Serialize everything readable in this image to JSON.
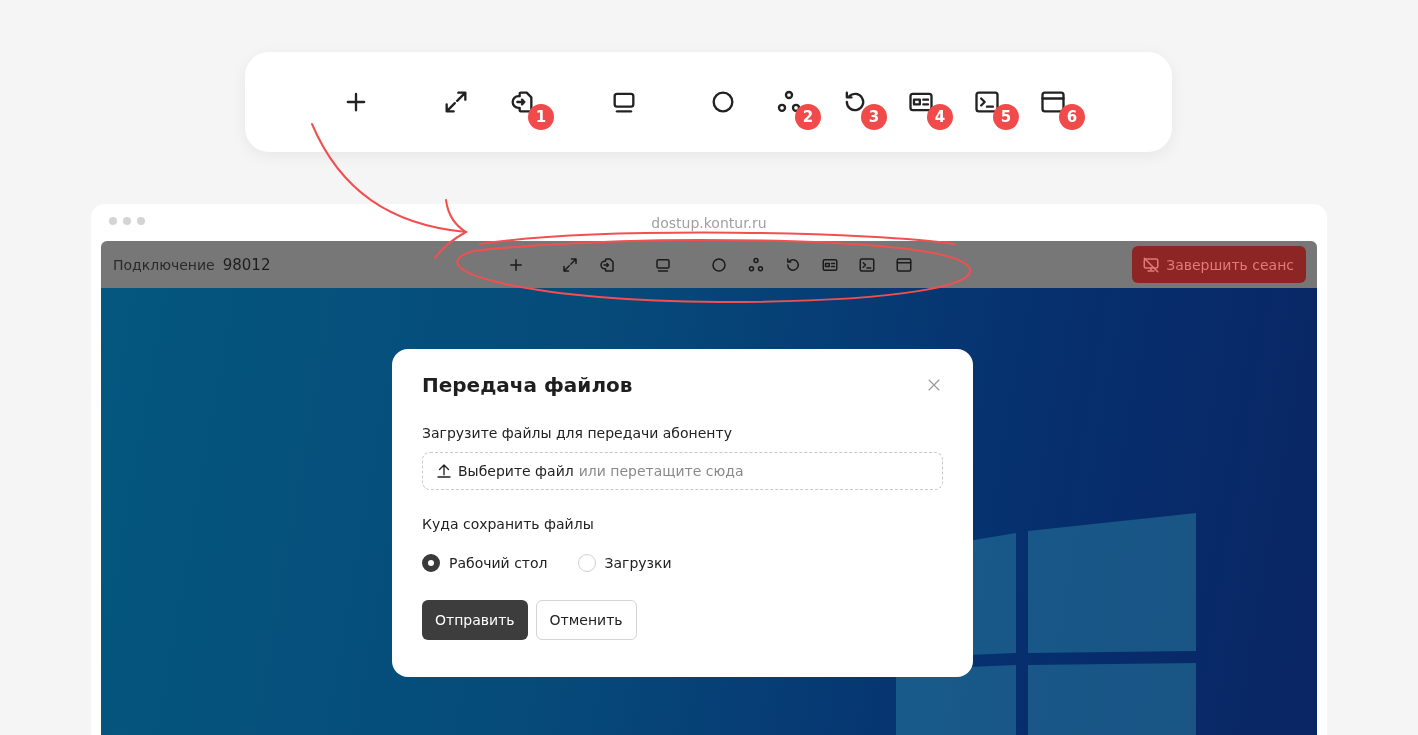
{
  "callout_toolbar": {
    "items": [
      {
        "kind": "plus"
      },
      {
        "kind": "expand"
      },
      {
        "kind": "file-transfer",
        "badge": "1"
      },
      {
        "kind": "monitor"
      },
      {
        "kind": "circle"
      },
      {
        "kind": "nodes",
        "badge": "2"
      },
      {
        "kind": "rotate",
        "badge": "3"
      },
      {
        "kind": "id-card",
        "badge": "4"
      },
      {
        "kind": "terminal",
        "badge": "5"
      },
      {
        "kind": "window",
        "badge": "6"
      }
    ]
  },
  "browser": {
    "url": "dostup.kontur.ru"
  },
  "session_bar": {
    "label": "Подключение",
    "connection_id": "98012",
    "toolbar": [
      {
        "kind": "plus"
      },
      {
        "kind": "expand"
      },
      {
        "kind": "file-transfer"
      },
      {
        "kind": "monitor"
      },
      {
        "kind": "circle"
      },
      {
        "kind": "nodes"
      },
      {
        "kind": "rotate"
      },
      {
        "kind": "id-card"
      },
      {
        "kind": "terminal"
      },
      {
        "kind": "window"
      }
    ],
    "end_button": "Завершить сеанс"
  },
  "dialog": {
    "title": "Передача файлов",
    "upload_label": "Загрузите файлы для передачи абоненту",
    "dropzone": {
      "link": "Выберите файл",
      "hint": "или перетащите сюда"
    },
    "save_label": "Куда сохранить файлы",
    "options": [
      {
        "label": "Рабочий стол",
        "selected": true
      },
      {
        "label": "Загрузки",
        "selected": false
      }
    ],
    "buttons": [
      {
        "label": "Отправить",
        "kind": "primary"
      },
      {
        "label": "Отменить",
        "kind": "secondary"
      }
    ]
  }
}
